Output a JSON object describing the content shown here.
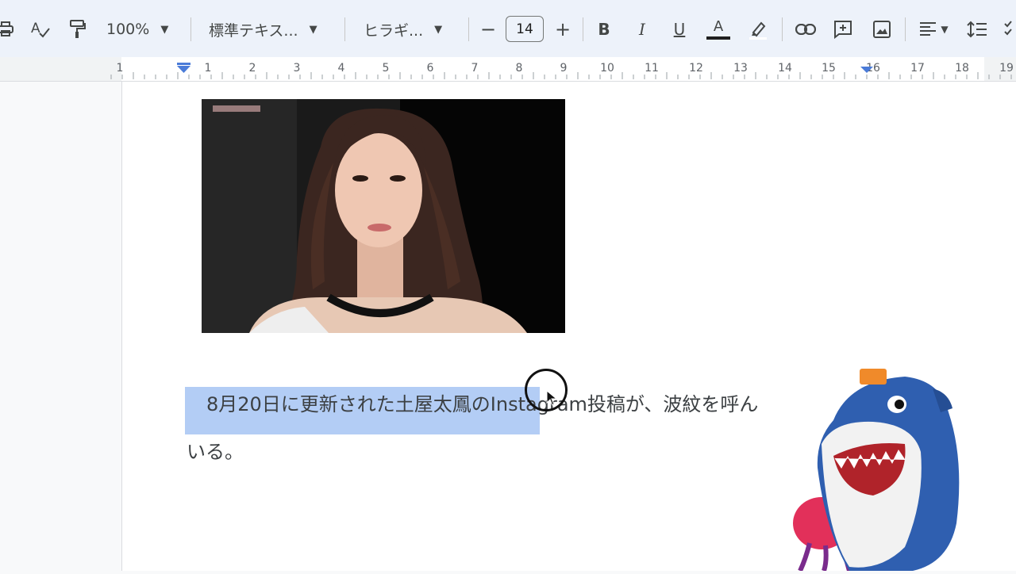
{
  "toolbar": {
    "zoom": "100%",
    "style": "標準テキス...",
    "font": "ヒラギ...",
    "font_size": "14",
    "minus": "−",
    "plus": "+",
    "bold": "B",
    "italic": "I",
    "underline": "U",
    "text_color": "A"
  },
  "ruler": {
    "numbers": [
      "1",
      "1",
      "2",
      "3",
      "4",
      "5",
      "6",
      "7",
      "8",
      "9",
      "10",
      "11",
      "12",
      "13",
      "14",
      "15",
      "16",
      "17",
      "18",
      "19"
    ]
  },
  "document": {
    "paragraph_line1": "8月20日に更新された土屋太鳳のInstagram投稿が、波紋を呼ん",
    "paragraph_line2": "いる。"
  },
  "colors": {
    "selection": "#b3cdf5",
    "toolbar_bg": "#edf2fa",
    "ruler_marker": "#4a7bd8"
  }
}
